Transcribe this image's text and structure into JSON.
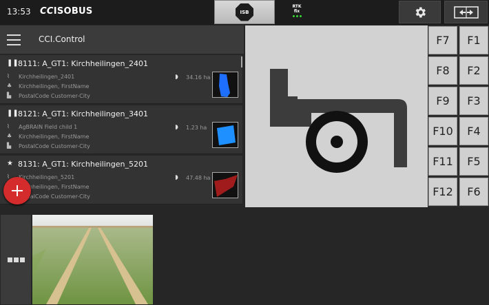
{
  "topbar": {
    "time": "13:53",
    "brand_prefix": "CC",
    "brand_suffix": "ISOBUS",
    "isb_label": "ISB",
    "rtk_line1": "RTK",
    "rtk_line2": "fix"
  },
  "app": {
    "title": "CCI.Control"
  },
  "tasks": [
    {
      "state_icon": "pause-icon",
      "state_glyph": "❚❚",
      "title": "8111: A_GT1: Kirchheilingen_2401",
      "field": "Kirchheilingen_2401",
      "customer": "Kirchheilingen, FirstName",
      "address": "PostalCode Customer-City",
      "area": "34.16 ha",
      "thumb_color": "#1f6fff"
    },
    {
      "state_icon": "pause-icon",
      "state_glyph": "❚❚",
      "title": "8121: A_GT1: Kirchheilingen_3401",
      "field": "AgBRAIN Field child 1",
      "customer": "Kirchheilingen, FirstName",
      "address": "PostalCode Customer-City",
      "area": "1.23 ha",
      "thumb_color": "#1e90ff"
    },
    {
      "state_icon": "star-icon",
      "state_glyph": "★",
      "title": "8131: A_GT1: Kirchheilingen_5201",
      "field": "Kirchheilingen_5201",
      "customer": "Kirchheilingen, FirstName",
      "address": "PostalCode Customer-City",
      "area": "47.48 ha",
      "thumb_color": "#a01c1c"
    }
  ],
  "function_keys": {
    "left": [
      "F7",
      "F8",
      "F9",
      "F10",
      "F11",
      "F12"
    ],
    "right": [
      "F1",
      "F2",
      "F3",
      "F4",
      "F5",
      "F6"
    ]
  },
  "colors": {
    "fab": "#d42c2c",
    "rtk_ok": "#38d838",
    "machine_bg": "#d2d2d2"
  }
}
